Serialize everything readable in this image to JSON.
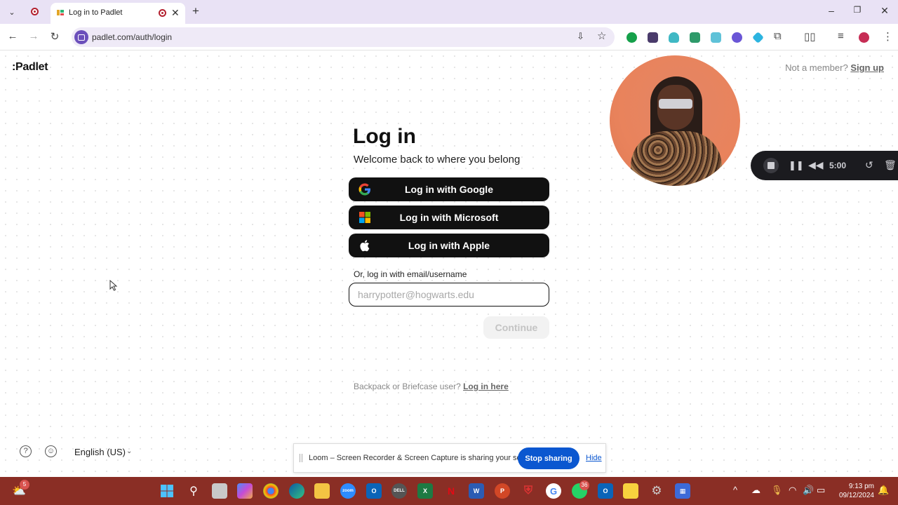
{
  "browser": {
    "tab_title": "Log in to Padlet",
    "url": "padlet.com/auth/login",
    "newtab_symbol": "+",
    "close_symbol": "✕"
  },
  "page": {
    "logo": ":Padlet",
    "member_prompt": "Not a member?",
    "signup_label": "Sign up",
    "title": "Log in",
    "subtitle": "Welcome back to where you belong",
    "google_label": "Log in with Google",
    "microsoft_label": "Log in with Microsoft",
    "apple_label": "Log in with Apple",
    "or_label": "Or, log in with email/username",
    "email_placeholder": "harrypotter@hogwarts.edu",
    "email_value": "",
    "continue_label": "Continue",
    "backpack_prompt": "Backpack or Briefcase user?",
    "backpack_link": "Log in here",
    "language": "English (US)"
  },
  "loom": {
    "timer": "5:00",
    "share_text": "Loom – Screen Recorder & Screen Capture is sharing your screen.",
    "stop_label": "Stop sharing",
    "hide_label": "Hide"
  },
  "taskbar": {
    "weather_badge": "5",
    "whatsapp_badge": "36",
    "time": "9:13 pm",
    "date": "09/12/2024"
  },
  "colors": {
    "tabstrip": "#e9e2f5",
    "taskbar": "#8a2e25",
    "stop_button": "#0b57d0",
    "sso_button": "#111111"
  }
}
